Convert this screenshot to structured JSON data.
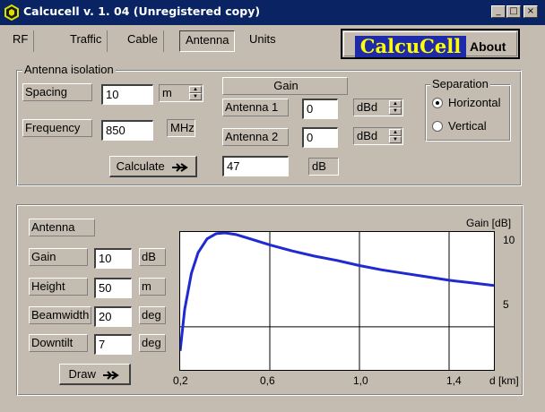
{
  "window": {
    "title": "Calcucell v. 1. 04 (Unregistered copy)",
    "minimize": "_",
    "maximize": "□",
    "close": "×"
  },
  "tabs": [
    "RF",
    "Traffic",
    "Cable",
    "Antenna",
    "Units"
  ],
  "active_tab": "Antenna",
  "about": {
    "logo": "CalcuCell",
    "label": "About"
  },
  "isolation": {
    "group_label": "Antenna isolation",
    "spacing_label": "Spacing",
    "spacing_value": "10",
    "spacing_unit": "m",
    "frequency_label": "Frequency",
    "frequency_value": "850",
    "frequency_unit": "MHz",
    "gain_header": "Gain",
    "antenna1_label": "Antenna 1",
    "antenna1_value": "0",
    "antenna1_unit": "dBd",
    "antenna2_label": "Antenna 2",
    "antenna2_value": "0",
    "antenna2_unit": "dBd",
    "calculate_label": "Calculate",
    "result_value": "47",
    "result_unit": "dB",
    "separation_label": "Separation",
    "horizontal_label": "Horizontal",
    "vertical_label": "Vertical",
    "separation_selected": "Horizontal"
  },
  "antenna": {
    "header": "Antenna",
    "gain_label": "Gain",
    "gain_value": "10",
    "gain_unit": "dB",
    "height_label": "Height",
    "height_value": "50",
    "height_unit": "m",
    "beamwidth_label": "Beamwidth",
    "beamwidth_value": "20",
    "beamwidth_unit": "deg",
    "downtilt_label": "Downtilt",
    "downtilt_value": "7",
    "downtilt_unit": "deg",
    "draw_label": "Draw"
  },
  "chart_data": {
    "type": "line",
    "ylabel": "Gain [dB]",
    "xlabel": "d [km]",
    "x_ticks": [
      "0,2",
      "0,6",
      "1,0",
      "1,4"
    ],
    "y_ticks": [
      "10",
      "5"
    ],
    "xlim": [
      0.2,
      1.6
    ],
    "ylim": [
      2.5,
      10.5
    ],
    "grid": true,
    "color": "#1f2ad0",
    "series": [
      {
        "x": [
          0.2,
          0.22,
          0.25,
          0.28,
          0.32,
          0.36,
          0.4,
          0.45,
          0.5,
          0.6,
          0.7,
          0.8,
          0.9,
          1.0,
          1.1,
          1.2,
          1.3,
          1.4,
          1.5,
          1.6
        ],
        "values": [
          3.6,
          6.0,
          8.1,
          9.3,
          10.1,
          10.4,
          10.45,
          10.35,
          10.15,
          9.75,
          9.4,
          9.1,
          8.85,
          8.55,
          8.3,
          8.1,
          7.9,
          7.7,
          7.55,
          7.4
        ]
      }
    ]
  }
}
